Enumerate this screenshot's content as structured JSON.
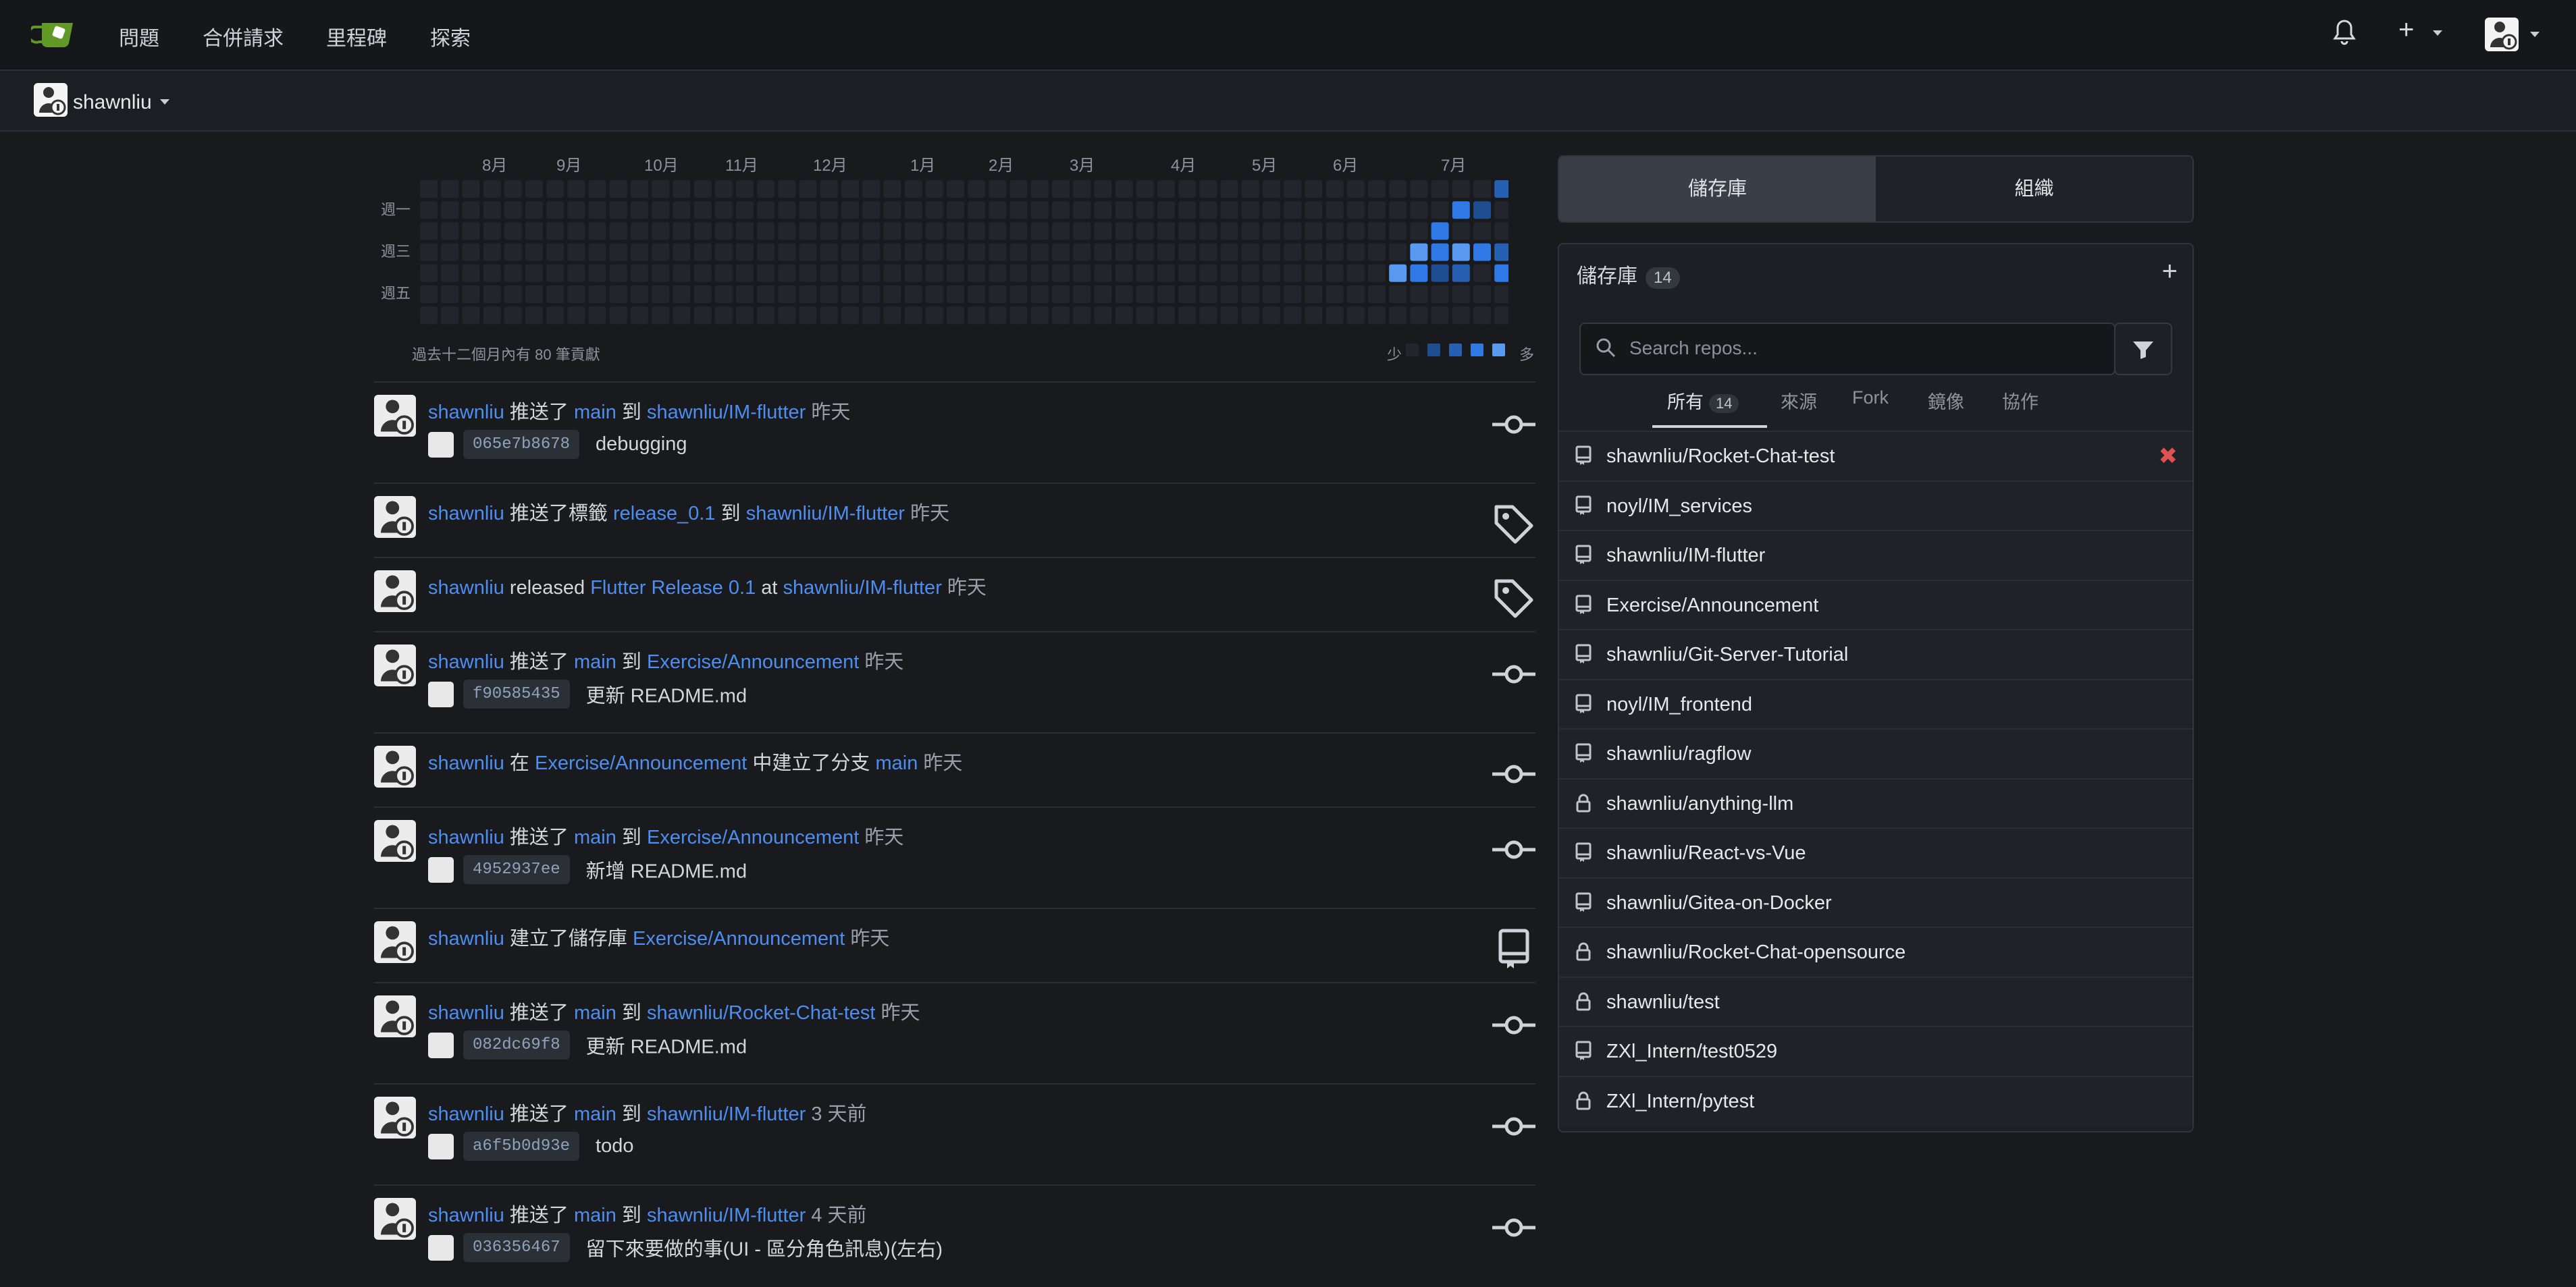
{
  "colors": {
    "background": "#181a1e",
    "accent": "#4d8ef0",
    "heat_empty": "#22262c",
    "heat_levels": [
      "#22262c",
      "#1e4d91",
      "#2660b3",
      "#2f79e6",
      "#5a99f2"
    ]
  },
  "top_nav": {
    "items": [
      "問題",
      "合併請求",
      "里程碑",
      "探索"
    ],
    "plus_symbol": "+"
  },
  "context": {
    "username": "shawnliu"
  },
  "heatmap": {
    "months": [
      "8月",
      "9月",
      "10月",
      "11月",
      "12月",
      "1月",
      "2月",
      "3月",
      "4月",
      "5月",
      "6月",
      "7月"
    ],
    "weekdays": [
      "週一",
      "週三",
      "週五"
    ],
    "summary": "過去十二個月內有 80 筆貢獻",
    "legend_less": "少",
    "legend_more": "多",
    "active_cells": [
      [
        51,
        0,
        2
      ],
      [
        49,
        1,
        3
      ],
      [
        52,
        1,
        4
      ],
      [
        50,
        1,
        1
      ],
      [
        52,
        0,
        3
      ],
      [
        48,
        2,
        3
      ],
      [
        50,
        3,
        2
      ],
      [
        47,
        3,
        4
      ],
      [
        48,
        3,
        3
      ],
      [
        49,
        3,
        4
      ],
      [
        50,
        3,
        3
      ],
      [
        51,
        3,
        2
      ],
      [
        52,
        3,
        1
      ],
      [
        46,
        4,
        4
      ],
      [
        49,
        4,
        2
      ],
      [
        51,
        4,
        3
      ],
      [
        52,
        4,
        1
      ],
      [
        48,
        4,
        1
      ],
      [
        47,
        4,
        3
      ]
    ]
  },
  "feed": {
    "items": [
      {
        "actor": "shawnliu",
        "verb": "推送了",
        "ref": "main",
        "prep": "到",
        "repo": "shawnliu/IM-flutter",
        "time": "昨天",
        "sha": "065e7b8678",
        "message": "debugging",
        "icon": "commit-icon"
      },
      {
        "actor": "shawnliu",
        "verb": "推送了標籤",
        "ref": "release_0.1",
        "prep": "到",
        "repo": "shawnliu/IM-flutter",
        "time": "昨天",
        "sha": "",
        "message": "",
        "icon": "tag-icon"
      },
      {
        "actor": "shawnliu",
        "verb": "released",
        "ref": "Flutter Release 0.1",
        "prep": "at",
        "repo": "shawnliu/IM-flutter",
        "time": "昨天",
        "sha": "",
        "message": "",
        "icon": "tag-icon"
      },
      {
        "actor": "shawnliu",
        "verb": "推送了",
        "ref": "main",
        "prep": "到",
        "repo": "Exercise/Announcement",
        "time": "昨天",
        "sha": "f90585435",
        "message": "更新 README.md",
        "icon": "commit-icon"
      },
      {
        "actor": "shawnliu",
        "verb": "在",
        "ref": "Exercise/Announcement",
        "prep": "中建立了分支",
        "repo": "main",
        "time": "昨天",
        "sha": "",
        "message": "",
        "icon": "commit-icon"
      },
      {
        "actor": "shawnliu",
        "verb": "推送了",
        "ref": "main",
        "prep": "到",
        "repo": "Exercise/Announcement",
        "time": "昨天",
        "sha": "4952937ee",
        "message": "新增 README.md",
        "icon": "commit-icon"
      },
      {
        "actor": "shawnliu",
        "verb": "建立了儲存庫",
        "ref": "Exercise/Announcement",
        "prep": "",
        "repo": "",
        "time": "昨天",
        "sha": "",
        "message": "",
        "icon": "repo-icon"
      },
      {
        "actor": "shawnliu",
        "verb": "推送了",
        "ref": "main",
        "prep": "到",
        "repo": "shawnliu/Rocket-Chat-test",
        "time": "昨天",
        "sha": "082dc69f8",
        "message": "更新 README.md",
        "icon": "commit-icon"
      },
      {
        "actor": "shawnliu",
        "verb": "推送了",
        "ref": "main",
        "prep": "到",
        "repo": "shawnliu/IM-flutter",
        "time": "3 天前",
        "sha": "a6f5b0d93e",
        "message": "todo",
        "icon": "commit-icon"
      },
      {
        "actor": "shawnliu",
        "verb": "推送了",
        "ref": "main",
        "prep": "到",
        "repo": "shawnliu/IM-flutter",
        "time": "4 天前",
        "sha": "036356467",
        "message": "留下來要做的事(UI - 區分角色訊息)(左右)",
        "icon": "commit-icon"
      }
    ]
  },
  "sidebar": {
    "tabs": [
      "儲存庫",
      "組織"
    ],
    "repo_header": "儲存庫",
    "repo_count": "14",
    "search_placeholder": "Search repos...",
    "filter_tabs": [
      "所有",
      "來源",
      "Fork",
      "鏡像",
      "協作"
    ],
    "filter_all_count": "14",
    "repos": [
      {
        "name": "shawnliu/Rocket-Chat-test",
        "private": false
      },
      {
        "name": "noyl/IM_services",
        "private": false
      },
      {
        "name": "shawnliu/IM-flutter",
        "private": false
      },
      {
        "name": "Exercise/Announcement",
        "private": false
      },
      {
        "name": "shawnliu/Git-Server-Tutorial",
        "private": false
      },
      {
        "name": "noyl/IM_frontend",
        "private": false
      },
      {
        "name": "shawnliu/ragflow",
        "private": false
      },
      {
        "name": "shawnliu/anything-llm",
        "private": true
      },
      {
        "name": "shawnliu/React-vs-Vue",
        "private": false
      },
      {
        "name": "shawnliu/Gitea-on-Docker",
        "private": false
      },
      {
        "name": "shawnliu/Rocket-Chat-opensource",
        "private": true
      },
      {
        "name": "shawnliu/test",
        "private": true
      },
      {
        "name": "ZXl_Intern/test0529",
        "private": false
      },
      {
        "name": "ZXl_Intern/pytest",
        "private": true
      }
    ]
  }
}
